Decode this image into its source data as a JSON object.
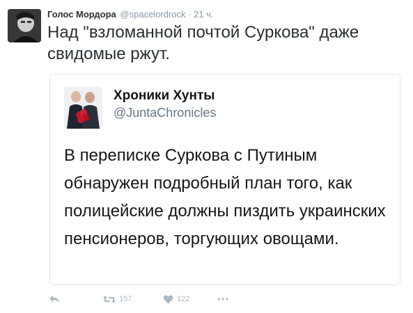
{
  "author": {
    "display_name": "Голос Мордора",
    "handle": "@spacelordrock",
    "separator": "·",
    "time": "21 ч."
  },
  "tweet_text": "Над \"взломанной почтой Суркова\" даже свидомые ржут.",
  "quoted": {
    "display_name": "Хроники Хунты",
    "handle": "@JuntaChronicles",
    "text": "В переписке Суркова с Путиным обнаружен подробный план того, как полицейские должны пиздить украинских пенсионеров, торгующих овощами."
  },
  "actions": {
    "retweets": "157",
    "likes": "122"
  },
  "icons": {
    "reply": "reply-icon",
    "retweet": "retweet-icon",
    "like": "heart-icon",
    "more": "more-icon"
  },
  "colors": {
    "text": "#292f33",
    "muted": "#8899a6",
    "action_gray": "#aab8c2",
    "border": "#e1e8ed"
  }
}
